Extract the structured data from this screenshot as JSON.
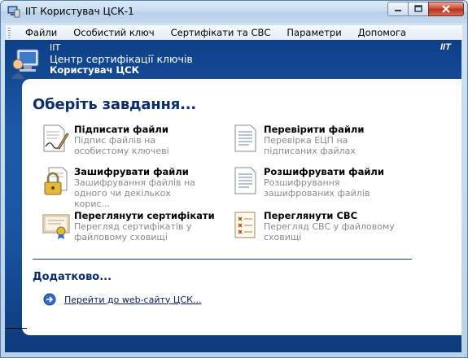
{
  "window": {
    "title": "IIT Користувач ЦСК-1",
    "controls": [
      "minimize",
      "maximize",
      "close"
    ]
  },
  "menu": [
    {
      "label": "Файли"
    },
    {
      "label": "Особистий ключ"
    },
    {
      "label": "Сертифікати та СВС"
    },
    {
      "label": "Параметри"
    },
    {
      "label": "Допомога"
    }
  ],
  "header": {
    "company": "IIT",
    "title": "Центр сертифікації ключів",
    "subtitle": "Користувач ЦСК",
    "brand": "IIT"
  },
  "tasks_heading": "Оберіть завдання...",
  "tasks": [
    {
      "name": "Підписати файли",
      "desc": "Підпис файлів на особистому ключеві",
      "icon": "sign-document-icon"
    },
    {
      "name": "Перевірити файли",
      "desc": "Перевірка ЕЦП на підписаних файлах",
      "icon": "verify-document-icon"
    },
    {
      "name": "Зашифрувати файли",
      "desc": "Зашифрування файлів на одного чи декількох корис...",
      "icon": "lock-document-icon"
    },
    {
      "name": "Розшифрувати файли",
      "desc": "Розшифрування зашифрованих файлів",
      "icon": "decrypt-document-icon"
    },
    {
      "name": "Переглянути сертифікати",
      "desc": "Перегляд сертифікатів у файловому сховищі",
      "icon": "certificate-icon"
    },
    {
      "name": "Переглянути СВС",
      "desc": "Перегляд СВС у файловому сховищі",
      "icon": "revocation-list-icon"
    }
  ],
  "extra": {
    "heading": "Додатково...",
    "link_label": "Перейти до web-сайту ЦСК..."
  }
}
